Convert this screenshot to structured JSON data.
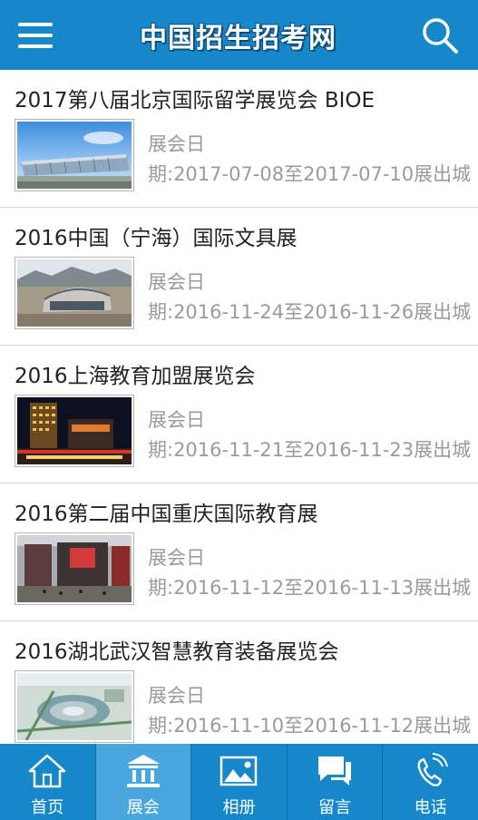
{
  "header": {
    "title": "中国招生招考网",
    "menu_icon": "hamburger-menu-icon",
    "search_icon": "search-icon"
  },
  "items": [
    {
      "title": "2017第八届北京国际留学展览会 BIOE",
      "meta_line1": "展会日",
      "meta_line2": "期:2017-07-08至2017-07-10展出城",
      "image": "exhibition-center-photo"
    },
    {
      "title": "2016中国（宁海）国际文具展",
      "meta_line1": "展会日",
      "meta_line2": "期:2016-11-24至2016-11-26展出城",
      "image": "stadium-photo"
    },
    {
      "title": "2016上海教育加盟展览会",
      "meta_line1": "展会日",
      "meta_line2": "期:2016-11-21至2016-11-23展出城",
      "image": "night-building-photo"
    },
    {
      "title": "2016第二届中国重庆国际教育展",
      "meta_line1": "展会日",
      "meta_line2": "期:2016-11-12至2016-11-13展出城",
      "image": "mall-facade-photo"
    },
    {
      "title": "2016湖北武汉智慧教育装备展览会",
      "meta_line1": "展会日",
      "meta_line2": "期:2016-11-10至2016-11-12展出城",
      "image": "aerial-rendering-photo"
    }
  ],
  "tabs": [
    {
      "label": "首页",
      "icon": "home-icon",
      "active": false
    },
    {
      "label": "展会",
      "icon": "bank-icon",
      "active": true
    },
    {
      "label": "相册",
      "icon": "picture-icon",
      "active": false
    },
    {
      "label": "留言",
      "icon": "chat-bubble-icon",
      "active": false
    },
    {
      "label": "电话",
      "icon": "phone-icon",
      "active": false
    }
  ],
  "colors": {
    "primary": "#1688c9",
    "active_tab": "#49a7dd",
    "meta_text": "#9a9a9a"
  }
}
